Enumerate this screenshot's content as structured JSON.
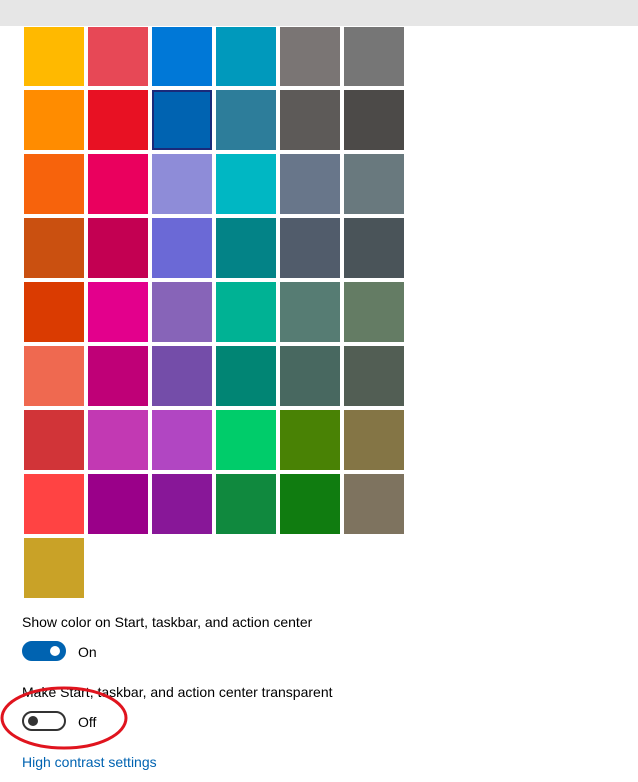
{
  "colors": [
    "#ffb900",
    "#e74856",
    "#0078d7",
    "#0099bc",
    "#7a7574",
    "#767676",
    "#ff8c00",
    "#e81123",
    "#0063b1",
    "#2d7d9a",
    "#5d5a58",
    "#4c4a48",
    "#f7630c",
    "#ea005e",
    "#8e8cd8",
    "#00b7c3",
    "#68768a",
    "#69797e",
    "#ca5010",
    "#c30052",
    "#6b69d6",
    "#038387",
    "#515c6b",
    "#4a5459",
    "#da3b01",
    "#e3008c",
    "#8764b8",
    "#00b294",
    "#567c73",
    "#647c64",
    "#ef6950",
    "#bf0077",
    "#744da9",
    "#018574",
    "#486860",
    "#525e54",
    "#d13438",
    "#c239b3",
    "#b146c2",
    "#00cc6a",
    "#498205",
    "#847545",
    "#ff4343",
    "#9a0089",
    "#881798",
    "#10893e",
    "#107c10",
    "#7e735f",
    "#c9a227"
  ],
  "selected_color": "#0063b1",
  "show_color": {
    "label": "Show color on Start, taskbar, and action center",
    "state": "On"
  },
  "transparency": {
    "label": "Make Start, taskbar, and action center transparent",
    "state": "Off"
  },
  "high_contrast_link": "High contrast settings",
  "annotation_color": "#e0141e"
}
